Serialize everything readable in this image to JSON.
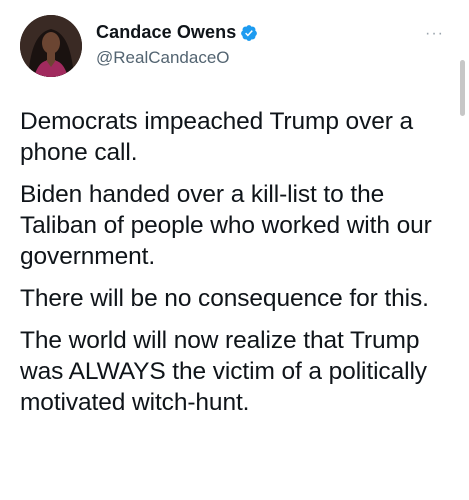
{
  "author": {
    "display_name": "Candace Owens",
    "handle": "@RealCandaceO",
    "verified": true,
    "avatar_icon": "profile-photo"
  },
  "actions": {
    "more_icon": "more-horizontal-icon",
    "more_label": "···"
  },
  "tweet": {
    "paragraphs": [
      "Democrats impeached Trump over a phone call.",
      "Biden handed over a kill-list to the Taliban of people who worked with our government.",
      "There will be no consequence for this.",
      "The world will now realize that Trump was ALWAYS the victim of a politically motivated witch-hunt."
    ]
  },
  "colors": {
    "text": "#0f1419",
    "secondary": "#536471",
    "verified_blue": "#1d9bf0",
    "background": "#ffffff"
  }
}
